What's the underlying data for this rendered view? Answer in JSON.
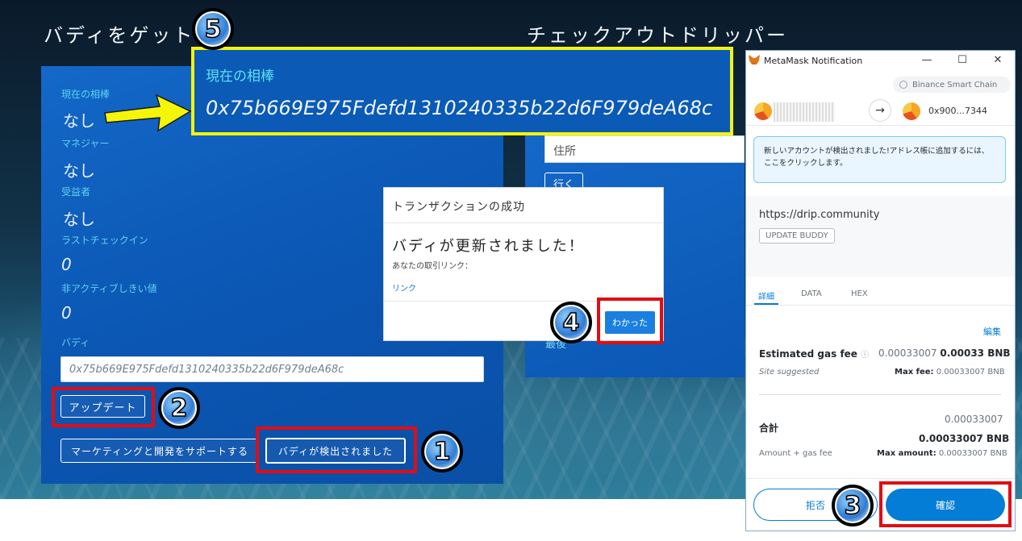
{
  "left_panel": {
    "title": "バディをゲット",
    "fields": [
      {
        "label": "現在の相棒",
        "value": "なし"
      },
      {
        "label": "マネジャー",
        "value": "なし"
      },
      {
        "label": "受益者",
        "value": "なし"
      },
      {
        "label": "ラストチェックイン",
        "value": "0"
      },
      {
        "label": "非アクティブしきい値",
        "value": "0"
      }
    ],
    "buddy_label": "バディ",
    "buddy_input_value": "0x75b669E975Fdefd1310240335b22d6F979deA68c",
    "update_button": "アップデート",
    "support_button": "マーケティングと開発をサポートする",
    "detected_button": "バディが検出されました"
  },
  "right_panel": {
    "title": "チェックアウトドリッパー",
    "address_placeholder": "住所",
    "go_button": "行く",
    "cut_text": "最後"
  },
  "callout": {
    "label": "現在の相棒",
    "address": "0x75b669E975Fdefd1310240335b22d6F979deA68c"
  },
  "badges": {
    "b1": "1",
    "b2": "2",
    "b3": "3",
    "b4": "4",
    "b5": "5"
  },
  "modal": {
    "title": "トランザクションの成功",
    "message": "バディが更新されました！",
    "sub": "あなたの取引リンク：",
    "link": "リンク",
    "ok_button": "わかった"
  },
  "metamask": {
    "window_title": "MetaMask Notification",
    "network": "Binance Smart Chain",
    "to_address": "0x900...7344",
    "notice": "新しいアカウントが検出されました!アドレス帳に追加するには、ここをクリックします。",
    "origin": "https://drip.community",
    "method": "UPDATE BUDDY",
    "tabs": [
      "詳細",
      "DATA",
      "HEX"
    ],
    "edit": "編集",
    "gas_label": "Estimated gas fee",
    "gas_value_muted": "0.00033007",
    "gas_value_bold": "0.00033 BNB",
    "site_suggested": "Site suggested",
    "max_fee_label": "Max fee:",
    "max_fee_value": "0.00033007 BNB",
    "total_label": "合計",
    "total_small": "0.00033007",
    "total_bold": "0.00033007 BNB",
    "amount_gas": "Amount + gas fee",
    "max_amount_label": "Max amount:",
    "max_amount_value": "0.00033007 BNB",
    "reject_button": "拒否",
    "confirm_button": "確認"
  },
  "colors": {
    "highlight_yellow": "#f5f50a",
    "highlight_red": "#e20d12",
    "metamask_blue": "#037dd6",
    "card_blue": "#0b57b4"
  }
}
